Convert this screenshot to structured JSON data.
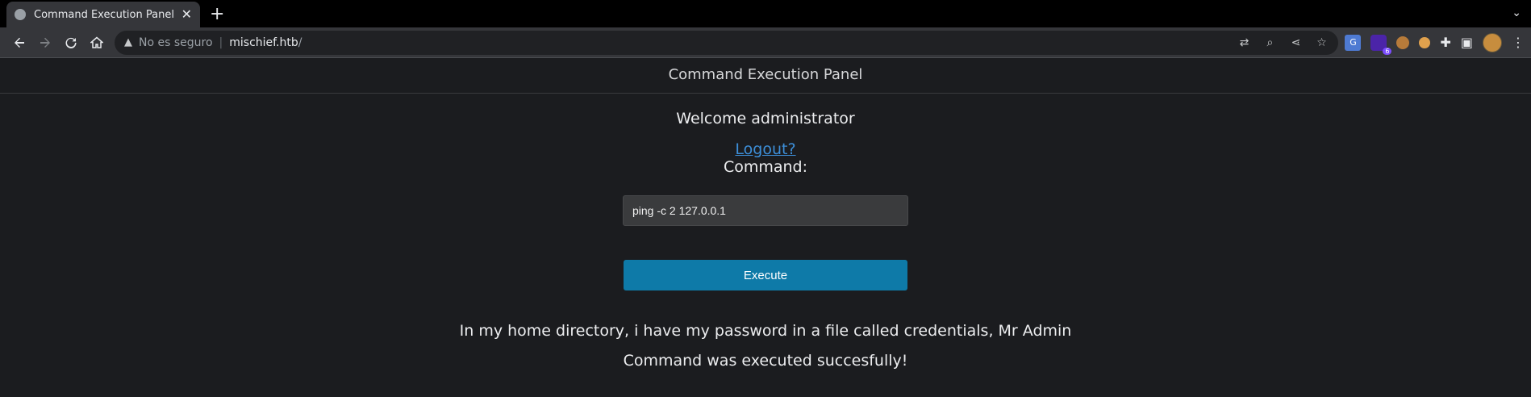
{
  "browser": {
    "tab_title": "Command Execution Panel (E",
    "new_tab_symbol": "+",
    "close_symbol": "✕",
    "tab_search_symbol": "⌄",
    "security_label": "No es seguro",
    "url_host": "mischief.htb",
    "url_path": "/",
    "extension_badge": "6",
    "icons": [
      "back-icon",
      "forward-icon",
      "reload-icon",
      "home-icon",
      "warning-icon",
      "translate-icon",
      "zoom-icon",
      "share-icon",
      "star-icon",
      "puzzle-icon",
      "sidepanel-icon",
      "menu-icon"
    ]
  },
  "page": {
    "header_title": "Command Execution Panel",
    "welcome": "Welcome administrator",
    "logout_link": "Logout?",
    "command_label": "Command:",
    "command_value": "ping -c 2 127.0.0.1",
    "execute_label": "Execute",
    "message": "In my home directory, i have my password in a file called credentials, Mr Admin",
    "result": "Command was executed succesfully!"
  },
  "colors": {
    "background": "#1b1c1f",
    "link": "#3d8fd9",
    "button": "#0e7aa8"
  }
}
